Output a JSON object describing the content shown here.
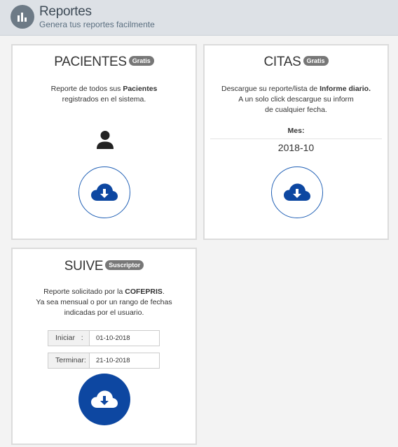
{
  "header": {
    "title": "Reportes",
    "subtitle": "Genera tus reportes facilmente",
    "icon": "bar-chart-icon"
  },
  "cards": {
    "pacientes": {
      "title": "PACIENTES",
      "badge": "Gratis",
      "desc_line1_pre": "Reporte de todos sus ",
      "desc_line1_bold": "Pacientes",
      "desc_line2": "registrados en el sistema.",
      "icon": "person-icon",
      "download_icon": "cloud-download-icon"
    },
    "citas": {
      "title": "CITAS",
      "badge": "Gratis",
      "desc_line1_pre": "Descargue su reporte/lista de ",
      "desc_line1_bold": "Informe diario.",
      "desc_line2": "A un solo click descargue su inform",
      "desc_line3": "de cualquier fecha.",
      "month_label": "Mes:",
      "month_value": "2018-10",
      "download_icon": "cloud-download-icon"
    },
    "suive": {
      "title": "SUIVE",
      "badge": "Suscriptor",
      "desc_line1_pre": "Reporte solicitado por la ",
      "desc_line1_bold": "COFEPRIS",
      "desc_line1_post": ".",
      "desc_line2": "Ya sea mensual o por un rango de fechas",
      "desc_line3": "indicadas por el usuario.",
      "start_label": "Iniciar   :",
      "start_value": "01-10-2018",
      "end_label": "Terminar:",
      "end_value": "21-10-2018",
      "download_icon": "cloud-download-icon"
    }
  },
  "colors": {
    "accent": "#0d47a1",
    "header_bg": "#dde1e6",
    "badge_bg": "#777777"
  }
}
